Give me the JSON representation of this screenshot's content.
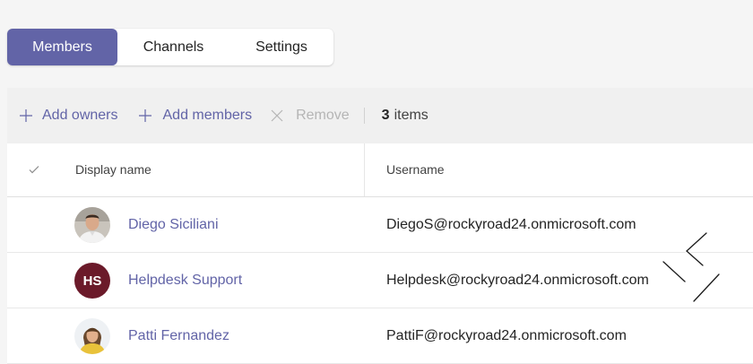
{
  "tabs": [
    {
      "label": "Members",
      "active": true
    },
    {
      "label": "Channels",
      "active": false
    },
    {
      "label": "Settings",
      "active": false
    }
  ],
  "toolbar": {
    "add_owners": "Add owners",
    "add_members": "Add members",
    "remove": "Remove",
    "item_count": "3",
    "item_count_suffix": "items"
  },
  "table": {
    "columns": [
      "Display name",
      "Username"
    ],
    "rows": [
      {
        "display_name": "Diego Siciliani",
        "username": "DiegoS@rockyroad24.onmicrosoft.com",
        "avatar": "photo"
      },
      {
        "display_name": "Helpdesk Support",
        "username": "Helpdesk@rockyroad24.onmicrosoft.com",
        "avatar": "initials",
        "initials": "HS"
      },
      {
        "display_name": "Patti Fernandez",
        "username": "PattiF@rockyroad24.onmicrosoft.com",
        "avatar": "photo"
      }
    ]
  },
  "colors": {
    "accent": "#6264a7",
    "hs_avatar_bg": "#6b1a2a",
    "page_bg": "#f5f5f5",
    "toolbar_bg": "#f0f0f0"
  },
  "icons": [
    "add-icon",
    "close-icon",
    "checkmark-icon",
    "resize-cursor-icon"
  ]
}
